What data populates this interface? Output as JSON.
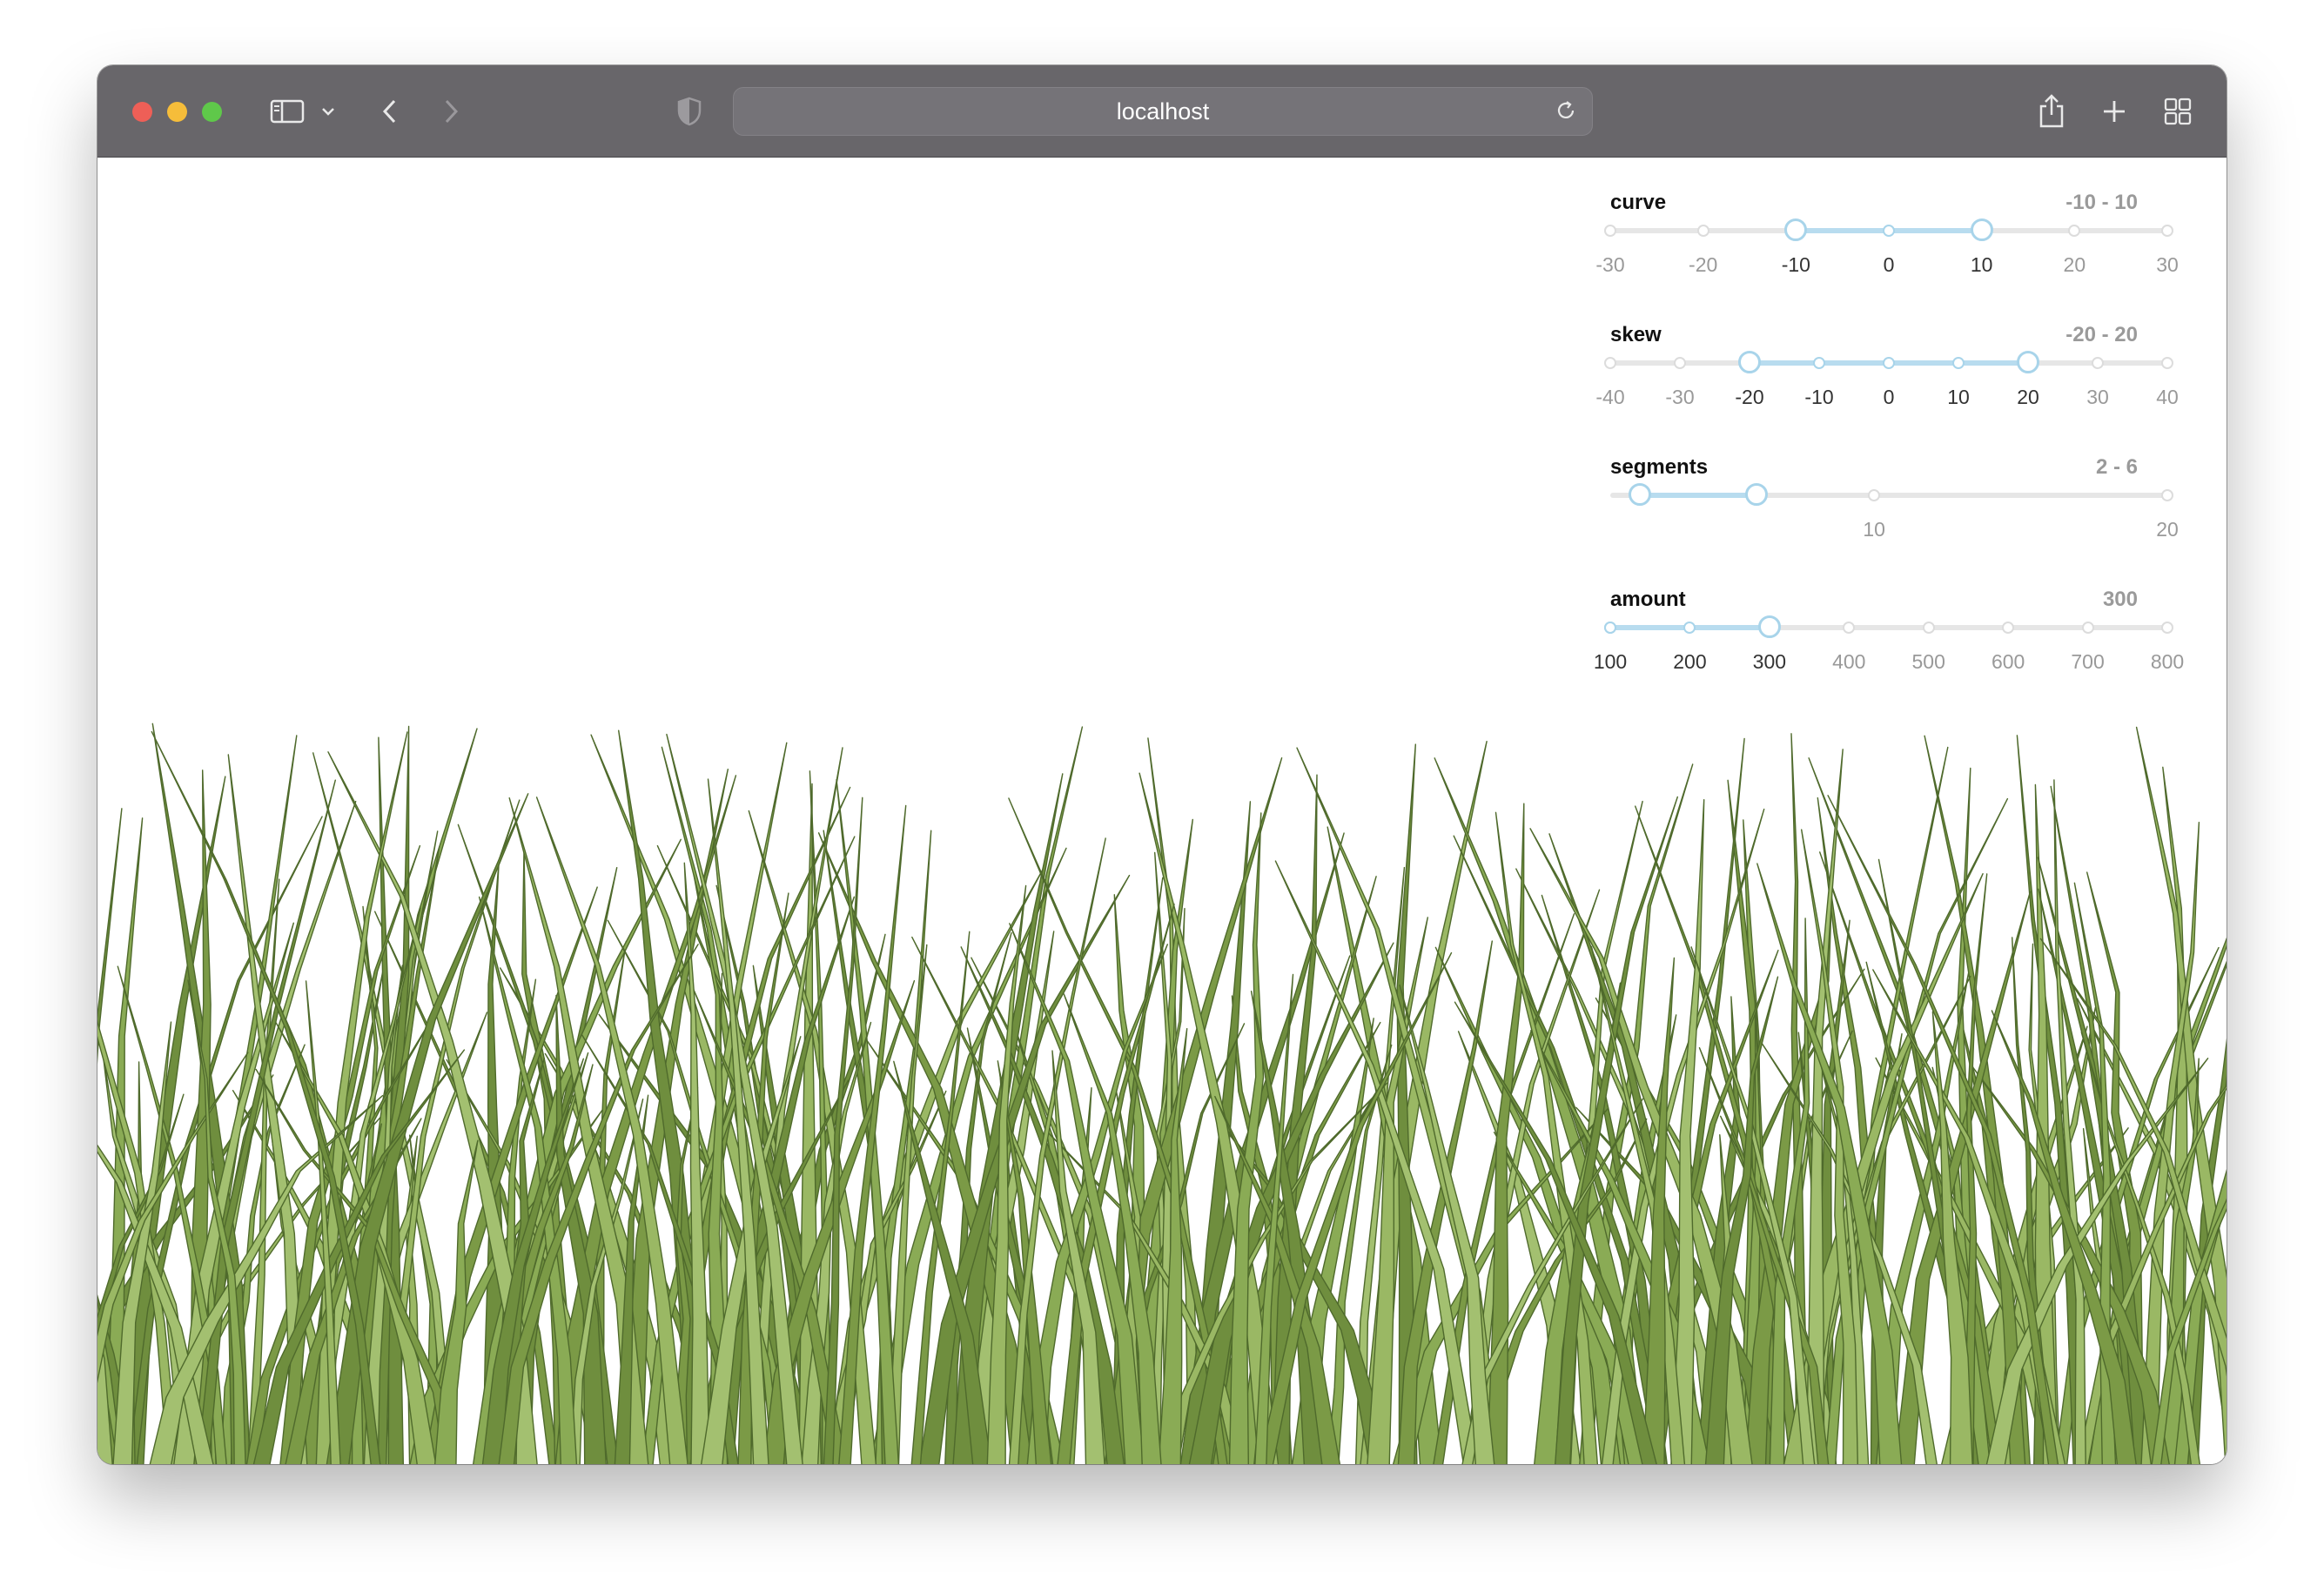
{
  "browser": {
    "url": "localhost"
  },
  "controls": [
    {
      "id": "curve",
      "label": "curve",
      "range_text": "-10 - 10",
      "min": -30,
      "max": 30,
      "value": [
        -10,
        10
      ],
      "marks": [
        "-30",
        "-20",
        "-10",
        "0",
        "10",
        "20",
        "30"
      ],
      "mark_values": [
        -30,
        -20,
        -10,
        0,
        10,
        20,
        30
      ]
    },
    {
      "id": "skew",
      "label": "skew",
      "range_text": "-20 - 20",
      "min": -40,
      "max": 40,
      "value": [
        -20,
        20
      ],
      "marks": [
        "-40",
        "-30",
        "-20",
        "-10",
        "0",
        "10",
        "20",
        "30",
        "40"
      ],
      "mark_values": [
        -40,
        -30,
        -20,
        -10,
        0,
        10,
        20,
        30,
        40
      ]
    },
    {
      "id": "segments",
      "label": "segments",
      "range_text": "2 - 6",
      "min": 1,
      "max": 20,
      "value": [
        2,
        6
      ],
      "marks": [
        "10",
        "20"
      ],
      "mark_values": [
        10,
        20
      ]
    },
    {
      "id": "amount",
      "label": "amount",
      "range_text": "300",
      "min": 100,
      "max": 800,
      "value": [
        100,
        300
      ],
      "marks": [
        "100",
        "200",
        "300",
        "400",
        "500",
        "600",
        "700",
        "800"
      ],
      "mark_values": [
        100,
        200,
        300,
        400,
        500,
        600,
        700,
        800
      ]
    }
  ],
  "grass_colors": [
    "#8aab55",
    "#9ab864",
    "#7b9a46",
    "#6f8e3e",
    "#a3c070"
  ],
  "grass_stroke": "#4f6a2c"
}
